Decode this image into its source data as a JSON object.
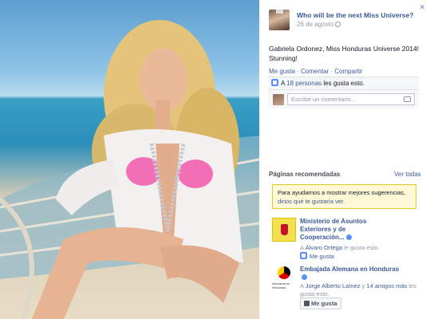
{
  "post": {
    "page_name": "Who will be the next Miss Universe?",
    "date": "26 de agosto",
    "text": "Gabriela Ordonez, Miss Honduras Universe 2014! Stunning!"
  },
  "actions": {
    "like": "Me gusta",
    "comment": "Comentar",
    "share": "Compartir"
  },
  "likes": {
    "prefix": "A ",
    "count_link": "18 personas",
    "suffix": " les gusta esto."
  },
  "comment_input": {
    "placeholder": "Escribe un comentario..."
  },
  "recommended": {
    "title": "Páginas recomendadas",
    "see_all": "Ver todas",
    "notice_text": "Para ayudarnos a mostrar mejores sugerencias, ",
    "notice_link": "dinos qué te gustaría ver."
  },
  "pages": [
    {
      "name": "Ministerio de Asuntos Exteriores y de Cooperación...",
      "friends_prefix": "A ",
      "friend_link": "Álvaro Ortega",
      "friends_suffix": " le gusta esto.",
      "like_label": "Me gusta"
    },
    {
      "name": "Embajada Alemana en Honduras",
      "logo_text": "Alemania en Honduras",
      "friends_prefix": "A ",
      "friend_link": "Jorge Alberto Laínez",
      "friends_middle": " y ",
      "friends_link2": "14 amigos más",
      "friends_suffix": " les gusta esto.",
      "like_label": "Me gusta"
    }
  ],
  "colors": {
    "link": "#3b5998",
    "muted": "#9197a3",
    "notice_bg": "#fff9d7"
  },
  "icons": [
    "close-icon",
    "globe-icon",
    "like-thumb-icon",
    "camera-icon",
    "verified-icon"
  ]
}
